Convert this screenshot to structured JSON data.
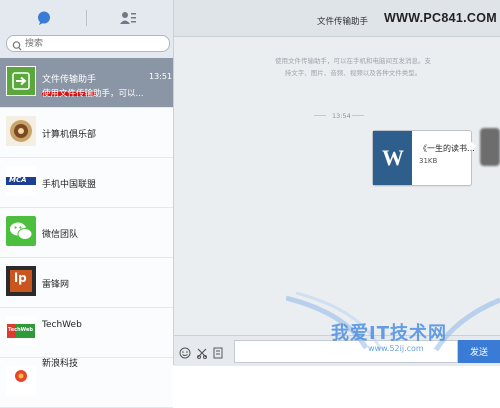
{
  "sidebar": {
    "search_placeholder": "搜索",
    "items": [
      {
        "name": "文件传输助手",
        "preview": "使用文件传输助手，可以...",
        "time": "13:51",
        "active": true
      },
      {
        "name": "计算机俱乐部"
      },
      {
        "name": "手机中国联盟"
      },
      {
        "name": "微信团队"
      },
      {
        "name": "雷锋网"
      },
      {
        "name": "TechWeb"
      },
      {
        "name": "新浪科技"
      }
    ],
    "avatar_labels": {
      "mca": "MCA",
      "leiphone": "lp",
      "techweb": "TechWeb"
    }
  },
  "chat": {
    "title": "文件传输助手",
    "notice": "使用文件传输助手，可以在手机和电脑间互发消息。支持文字、图片、音频、视频以及各种文件类型。",
    "timestamp": "13:54",
    "file": {
      "icon_letter": "W",
      "name": "《一生的读书...",
      "size": "31KB"
    },
    "send_label": "发送"
  },
  "watermarks": {
    "top": "WWW.PC841.COM",
    "bottom": "我爱IT技术网",
    "bottom_url": "www.52ij.com"
  },
  "colors": {
    "accent": "#3a7bd5",
    "active_row": "#8a96a6",
    "file_icon": "#2e5e8c",
    "highlight_underline": "#d81010"
  }
}
